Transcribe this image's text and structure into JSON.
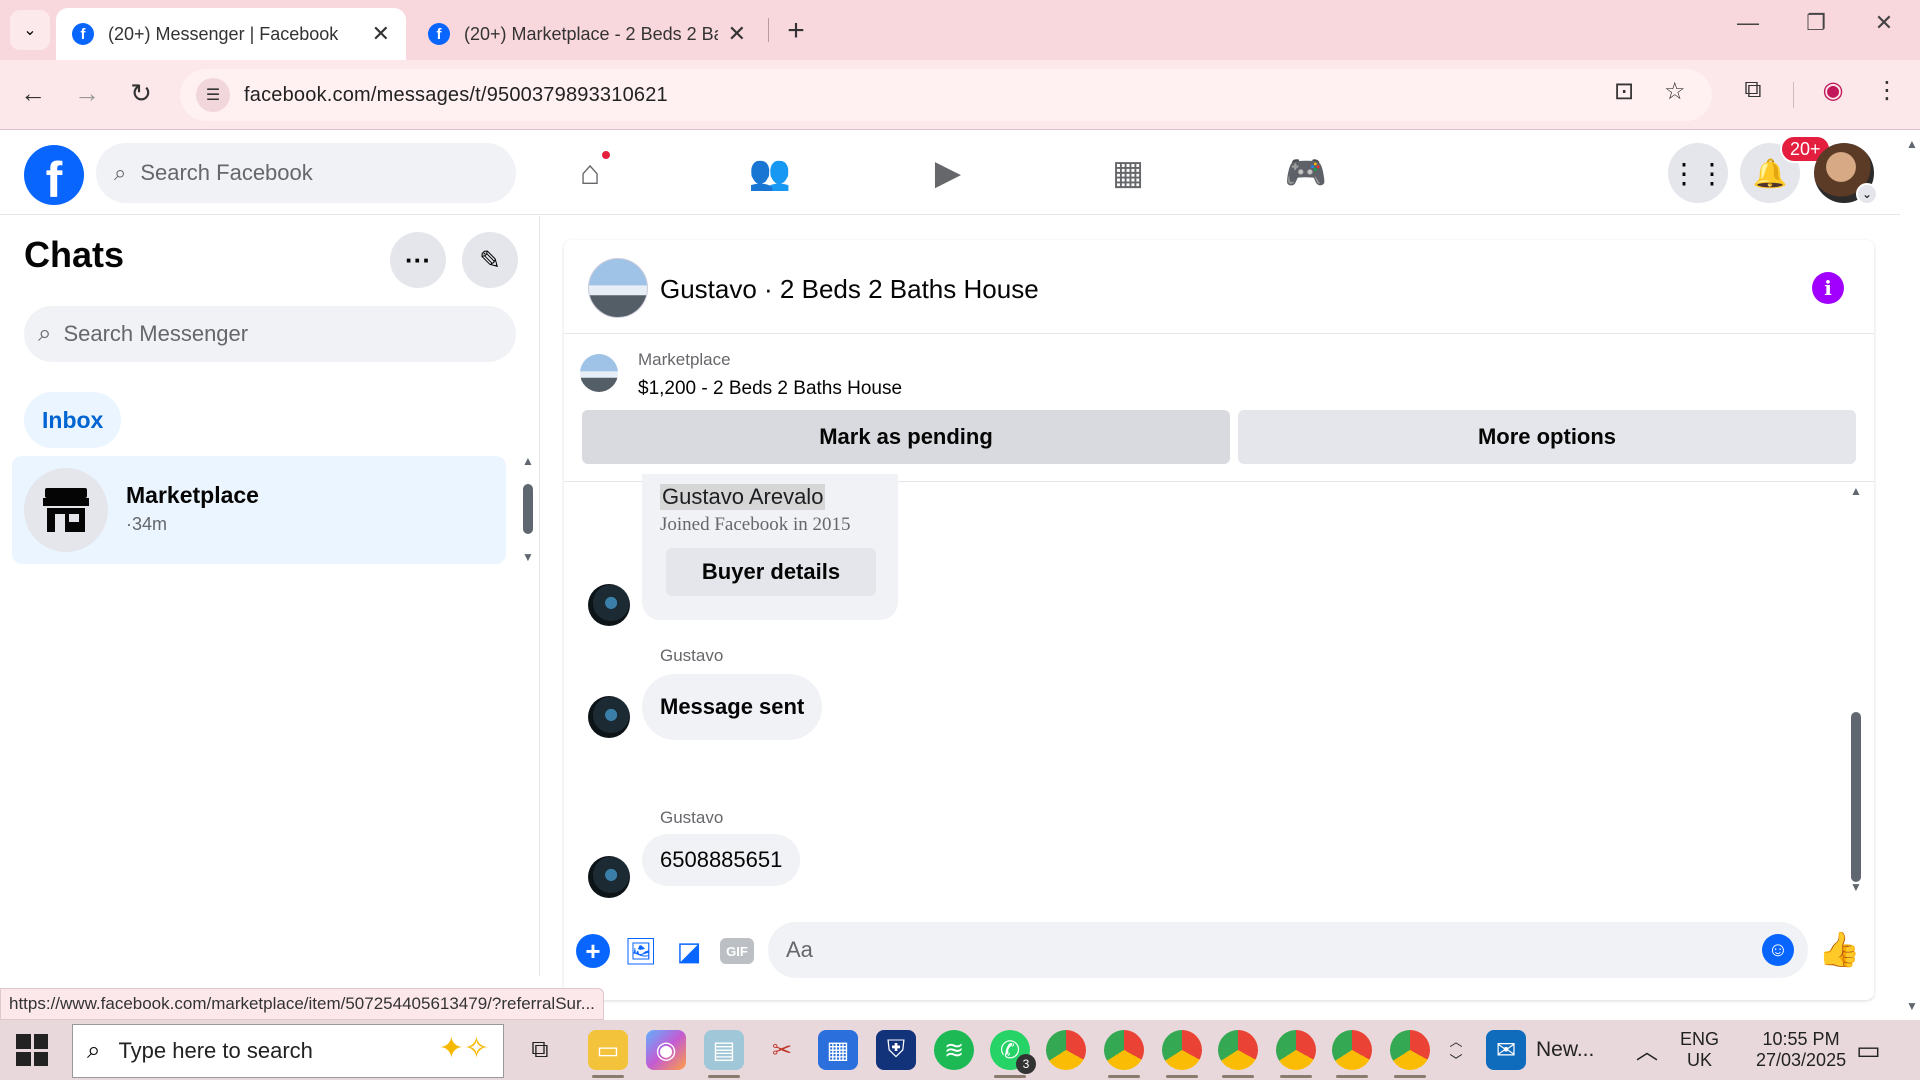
{
  "browser": {
    "tabs": [
      {
        "title": "(20+) Messenger | Facebook",
        "active": true
      },
      {
        "title": "(20+) Marketplace - 2 Beds 2 Ba",
        "active": false
      }
    ],
    "url": "facebook.com/messages/t/9500379893310621",
    "status_url": "https://www.facebook.com/marketplace/item/507254405613479/?referralSur..."
  },
  "facebook": {
    "search_placeholder": "Search Facebook",
    "notification_badge": "20+",
    "brand_color": "#0866ff"
  },
  "chats": {
    "title": "Chats",
    "search_placeholder": "Search Messenger",
    "filter_label": "Inbox",
    "items": [
      {
        "name": "Marketplace",
        "time": "·34m"
      }
    ]
  },
  "conversation": {
    "title": "Gustavo · 2 Beds 2 Baths House",
    "listing": {
      "source": "Marketplace",
      "item": "$1,200 - 2 Beds 2 Baths House",
      "pending_button": "Mark as pending",
      "more_button": "More options"
    },
    "buyer_card": {
      "name": "Gustavo Arevalo",
      "joined": "Joined Facebook in 2015",
      "button": "Buyer details"
    },
    "messages": [
      {
        "sender": "Gustavo",
        "text": "Message sent"
      },
      {
        "sender": "Gustavo",
        "text": "6508885651"
      }
    ],
    "composer_placeholder": "Aa"
  },
  "taskbar": {
    "search_placeholder": "Type here to search",
    "whatsapp_badge": "3",
    "outlook_label": "New...",
    "language": "ENG",
    "region": "UK",
    "time": "10:55 PM",
    "date": "27/03/2025"
  }
}
